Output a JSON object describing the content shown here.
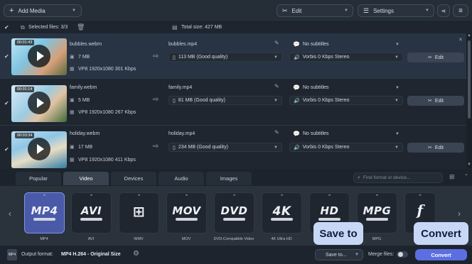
{
  "toolbar": {
    "add_media": "Add Media",
    "edit": "Edit",
    "settings": "Settings"
  },
  "info": {
    "selected_files": "Selected files: 3/3",
    "total_size": "Total size: 427 MB"
  },
  "files": [
    {
      "duration": "00:01:43",
      "name": "bubbles.webm",
      "size": "7 MB",
      "codec": "VP8 1920x1080 301 Kbps",
      "output_name": "bubbles.mp4",
      "output_size": "113 MB (Good quality)",
      "subtitles": "No subtitles",
      "audio": "Vorbis 0 Kbps Stereo",
      "edit_label": "Edit"
    },
    {
      "duration": "00:01:14",
      "name": "family.webm",
      "size": "5 MB",
      "codec": "VP8 1920x1080 267 Kbps",
      "output_name": "family.mp4",
      "output_size": "81 MB (Good quality)",
      "subtitles": "No subtitles",
      "audio": "Vorbis 0 Kbps Stereo",
      "edit_label": "Edit"
    },
    {
      "duration": "00:03:34",
      "name": "holiday.webm",
      "size": "17 MB",
      "codec": "VP8 1920x1080 411 Kbps",
      "output_name": "holiday.mp4",
      "output_size": "234 MB (Good quality)",
      "subtitles": "No subtitles",
      "audio": "Vorbis 0 Kbps Stereo",
      "edit_label": "Edit"
    }
  ],
  "tabs": [
    "Popular",
    "Video",
    "Devices",
    "Audio",
    "Images"
  ],
  "active_tab": "Video",
  "search": {
    "placeholder": "Find format or device..."
  },
  "formats": [
    {
      "logo": "MP4",
      "label": "MP4",
      "selected": true
    },
    {
      "logo": "AVI",
      "label": "AVI"
    },
    {
      "logo": "⊞",
      "label": "WMV"
    },
    {
      "logo": "MOV",
      "label": "MOV"
    },
    {
      "logo": "DVD",
      "label": "DVD-Compatible Video"
    },
    {
      "logo": "4K",
      "label": "4K Ultra HD"
    },
    {
      "logo": "HD",
      "label": ""
    },
    {
      "logo": "MPG",
      "label": "MPG"
    },
    {
      "logo": "f",
      "label": ""
    }
  ],
  "bottom": {
    "output_format_label": "Output format:",
    "output_format_value": "MP4 H.264 - Original Size",
    "save_to": "Save to...",
    "merge_files": "Merge files:",
    "convert": "Convert"
  },
  "callouts": {
    "save_to": "Save to",
    "convert": "Convert"
  },
  "colors": {
    "accent": "#5b6fe0",
    "selected_format": "#4a5aa8",
    "callout": "#c7d8f7"
  }
}
